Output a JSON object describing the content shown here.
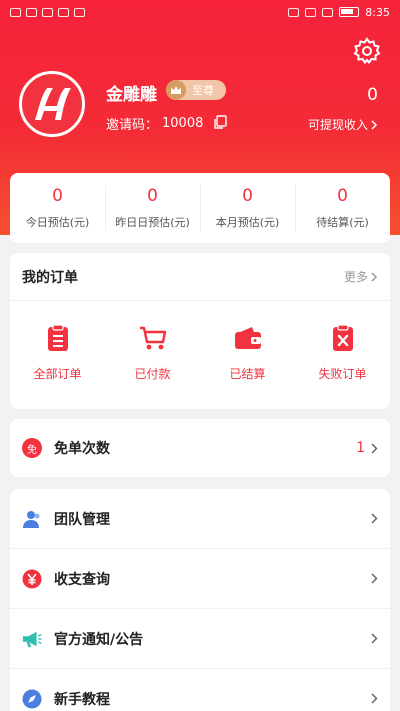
{
  "status_bar": {
    "time": "8:35"
  },
  "header": {
    "settings_icon": "gear-icon",
    "avatar_icon": "logo-h-icon",
    "username": "金雕雕",
    "vip_label": "至尊",
    "invite_label": "邀请码：",
    "invite_code": "10008",
    "balance": "0",
    "withdraw_label": "可提现收入"
  },
  "stats": [
    {
      "value": "0",
      "label": "今日预估(元)"
    },
    {
      "value": "0",
      "label": "昨日日预估(元)"
    },
    {
      "value": "0",
      "label": "本月预估(元)"
    },
    {
      "value": "0",
      "label": "待结算(元)"
    }
  ],
  "orders": {
    "title": "我的订单",
    "more_label": "更多",
    "items": [
      {
        "label": "全部订单",
        "icon": "clipboard-icon"
      },
      {
        "label": "已付款",
        "icon": "cart-icon"
      },
      {
        "label": "已结算",
        "icon": "wallet-icon"
      },
      {
        "label": "失败订单",
        "icon": "failed-order-icon"
      }
    ]
  },
  "free": {
    "icon_text": "免",
    "label": "免单次数",
    "count": "1"
  },
  "menu": [
    {
      "label": "团队管理",
      "icon": "team-icon"
    },
    {
      "label": "收支查询",
      "icon": "yuan-icon"
    },
    {
      "label": "官方通知/公告",
      "icon": "megaphone-icon"
    },
    {
      "label": "新手教程",
      "icon": "compass-icon"
    }
  ],
  "colors": {
    "primary": "#f2323f",
    "hero_top": "#f6233b",
    "hero_bottom": "#f6502f",
    "team_blue": "#4a7fe0",
    "notice_teal": "#2fbfae"
  }
}
